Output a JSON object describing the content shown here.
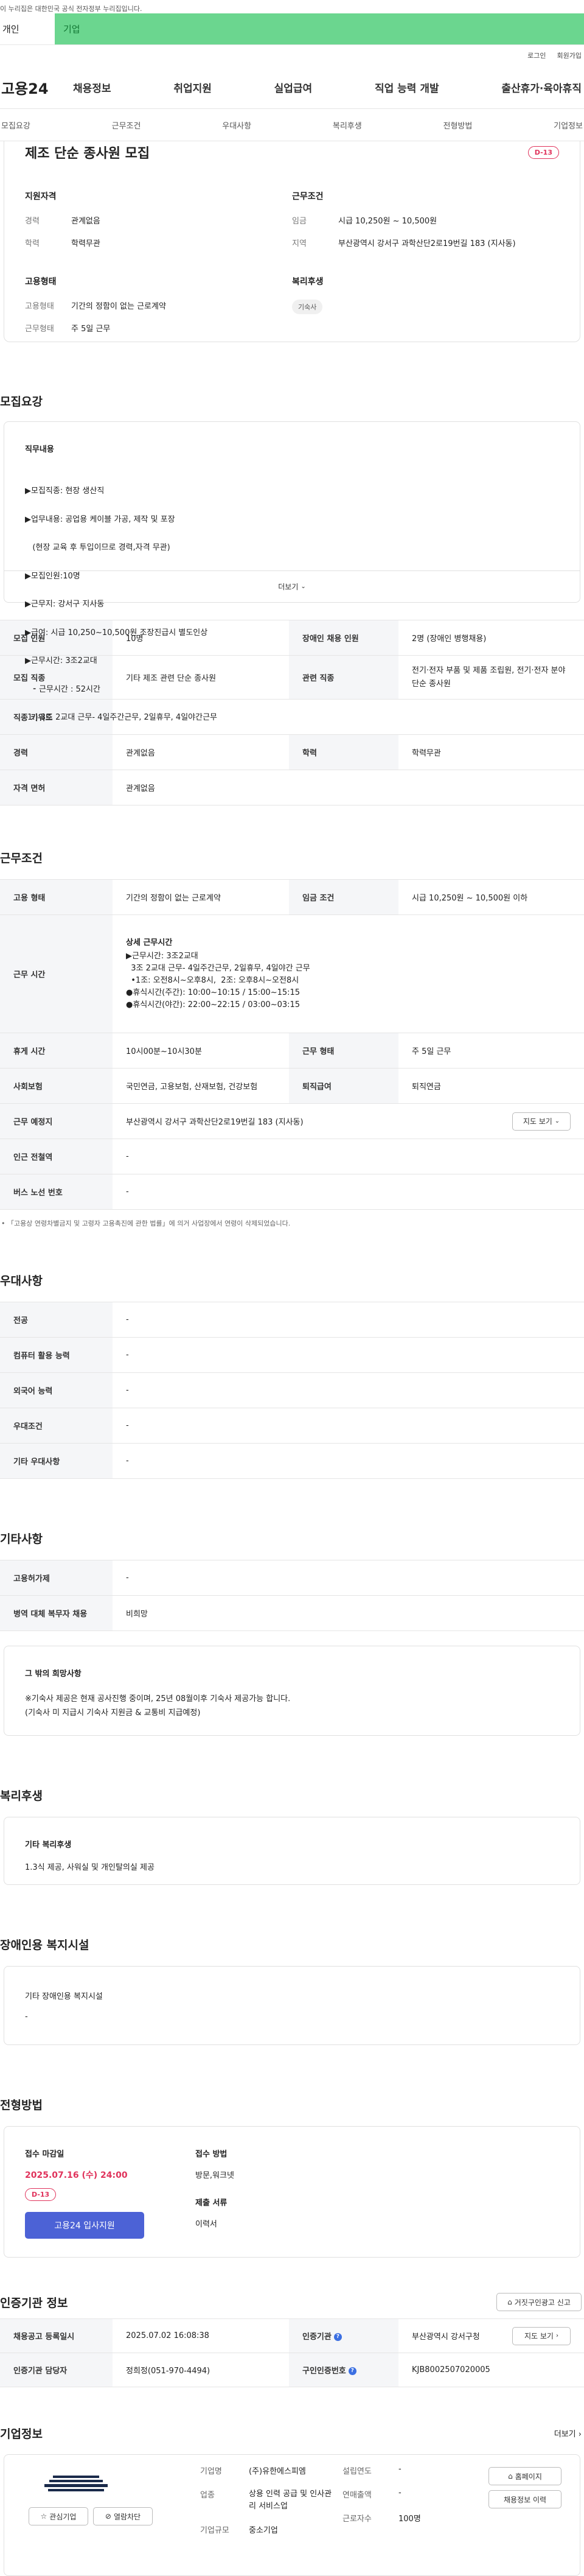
{
  "notice": "이 누리집은 대한민국 공식 전자정부 누리집입니다.",
  "user_tabs": [
    "개인",
    "기업"
  ],
  "util": [
    "로그인",
    "회원가입"
  ],
  "logo": "고용24",
  "gnb": [
    "채용정보",
    "취업지원",
    "실업급여",
    "직업 능력 개발",
    "출산휴가·육아휴직"
  ],
  "anchors": [
    "모집요강",
    "근무조건",
    "우대사항",
    "복리후생",
    "전형방법",
    "기업정보"
  ],
  "job": {
    "title": "제조 단순 종사원 모집",
    "dday": "D-13",
    "qual_heading": "지원자격",
    "career_k": "경력",
    "career_v": "관계없음",
    "edu_k": "학력",
    "edu_v": "학력무관",
    "cond_heading": "근무조건",
    "wage_k": "임금",
    "wage_v": "시급 10,250원 ~ 10,500원",
    "region_k": "지역",
    "region_v": "부산광역시 강서구 과학산단2로19번길 183 (지사동)",
    "emp_heading": "고용형태",
    "emptype_k": "고용형태",
    "emptype_v": "기간의 정함이 없는 근로계약",
    "worktype_k": "근무형태",
    "worktype_v": "주 5일 근무",
    "welfare_heading": "복리후생",
    "welfare_chip": "기숙사"
  },
  "recruit": {
    "heading": "모집요강",
    "duty_heading": "직무내용",
    "duty_lines": [
      "▶모집직종: 현장 생산직",
      "▶업무내용: 공업용 케이블 가공, 제작 및 포장",
      "   (현장 교육 후 투입이므로 경력,자격 무관)",
      "▶모집인원:10명",
      "▶근무지: 강서구 지사동",
      "▶급여: 시급 10,250~10,500원 조장진급시 별도인상",
      "▶근무시간: 3조2교대",
      "   ⁃ 근무시간 : 52시간",
      " 1.) 3조 2교대 근무- 4일주간근무, 2일휴무, 4일야간근무"
    ],
    "more_label": "더보기",
    "rows": [
      {
        "k1": "모집 인원",
        "v1": "10명",
        "k2": "장애인 채용 인원",
        "v2": "2명 (장애인 병행채용)"
      },
      {
        "k1": "모집 직종",
        "v1": "기타 제조 관련 단순 종사원",
        "k2": "관련 직종",
        "v2": "전기·전자 부품 및 제품 조립원, 전기·전자 분야 단순 종사원"
      },
      {
        "k1": "직종 키워드",
        "v1": "-"
      },
      {
        "k1": "경력",
        "v1": "관계없음",
        "k2": "학력",
        "v2": "학력무관"
      },
      {
        "k1": "자격 면허",
        "v1": "관계없음"
      }
    ]
  },
  "work": {
    "heading": "근무조건",
    "emptype_k": "고용 형태",
    "emptype_v": "기간의 정함이 없는 근로계약",
    "wage_k": "임금 조건",
    "wage_v": "시급 10,250원 ~ 10,500원 이하",
    "hours_k": "근무 시간",
    "hours_title": "상세 근무시간",
    "hours_lines": [
      "▶근무시간: 3조2교대",
      "  3조 2교대 근무- 4일주간근무, 2일휴무, 4일야간 근무",
      "  •1조: 오전8시~오후8시,  2조: 오후8시~오전8시",
      "●휴식시간(주간): 10:00~10:15 / 15:00~15:15",
      "●휴식시간(야간): 22:00~22:15 / 03:00~03:15"
    ],
    "break_k": "휴게 시간",
    "break_v": "10시00분~10시30분",
    "shape_k": "근무 형태",
    "shape_v": "주 5일 근무",
    "insurance_k": "사회보험",
    "insurance_v": "국민연금, 고용보험, 산재보험, 건강보험",
    "retire_k": "퇴직급여",
    "retire_v": "퇴직연금",
    "place_k": "근무 예정지",
    "place_v": "부산광역시 강서구 과학산단2로19번길 183 (지사동)",
    "map_label": "지도 보기",
    "subway_k": "인근 전철역",
    "subway_v": "-",
    "bus_k": "버스 노선 번호",
    "bus_v": "-",
    "note": "「고용상 연령차별금지 및 고령자 고용촉진에 관한 법률」에 의거 사업장에서 연령이 삭제되었습니다."
  },
  "pref": {
    "heading": "우대사항",
    "rows": [
      {
        "k": "전공",
        "v": "-"
      },
      {
        "k": "컴퓨터 활용 능력",
        "v": "-"
      },
      {
        "k": "외국어 능력",
        "v": "-"
      },
      {
        "k": "우대조건",
        "v": "-"
      },
      {
        "k": "기타 우대사항",
        "v": "-"
      }
    ]
  },
  "etc": {
    "heading": "기타사항",
    "rows": [
      {
        "k": "고용허가제",
        "v": "-"
      },
      {
        "k": "병역 대체 복무자 채용",
        "v": "비희망"
      }
    ],
    "other_title": "그 밖의 희망사항",
    "other_lines": [
      "※기숙사 제공은 현재 공사진행 중이며, 25년 08월이후 기숙사 제공가능 합니다.",
      "(기숙사 미 지급시 기숙사 지원금 & 교통비 지급예정)"
    ]
  },
  "welfare": {
    "heading": "복리후생",
    "title": "기타 복리후생",
    "text": "1.3식 제공, 사워실 및 개인탈의실 제공"
  },
  "disability": {
    "heading": "장애인용 복지시설",
    "title": "기타 장애인용 복지시설",
    "text": "-"
  },
  "selection": {
    "heading": "전형방법",
    "deadline_title": "접수 마감일",
    "deadline": "2025.07.16 (수) 24:00",
    "dday": "D-13",
    "apply_label": "고용24 입사지원",
    "method_title": "접수 방법",
    "method": "방문,워크넷",
    "docs_title": "제출 서류",
    "docs": "이력서"
  },
  "cert": {
    "heading": "인증기관 정보",
    "report_label": "거짓구인광고 신고",
    "r1k1": "채용공고 등록일시",
    "r1v1": "2025.07.02 16:08:38",
    "r1k2": "인증기관",
    "r1v2": "부산광역시 강서구청",
    "view_label": "지도 보기",
    "r2k1": "인증기관 담당자",
    "r2v1": "정희정(051-970-4494)",
    "r2k2": "구인인증번호",
    "r2v2": "KJB8002507020005"
  },
  "company": {
    "heading": "기업정보",
    "more_label": "더보기",
    "fav_label": "관심기업",
    "block_label": "열람차단",
    "name_k": "기업명",
    "name_v": "(주)유한에스피엠",
    "biz_k": "업종",
    "biz_v": "상용 인력 공급 및 인사관리 서비스업",
    "scale_k": "기업규모",
    "scale_v": "중소기업",
    "est_k": "설립연도",
    "est_v": "-",
    "sales_k": "연매출액",
    "sales_v": "-",
    "emp_k": "근로자수",
    "emp_v": "100명",
    "home_label": "홈페이지",
    "jobs_label": "채용정보 이력"
  }
}
